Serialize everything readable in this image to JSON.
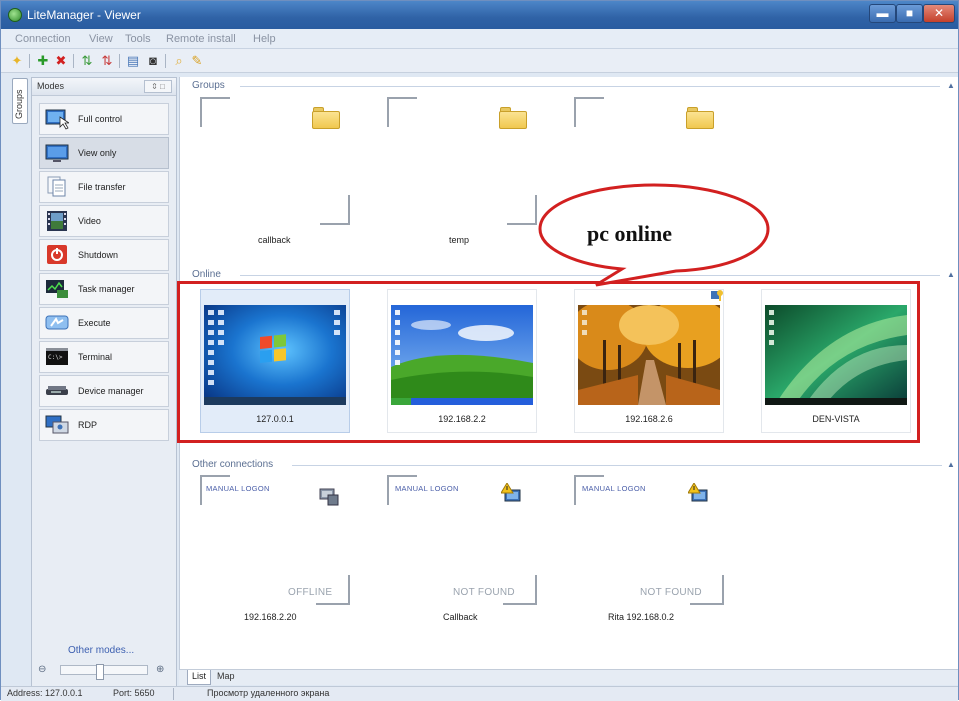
{
  "window": {
    "title": "LiteManager - Viewer",
    "controls": {
      "minimize": "▬",
      "maximize": "■",
      "close": "✕"
    }
  },
  "menu": [
    "Connection",
    "View",
    "Tools",
    "Remote install",
    "Help"
  ],
  "side_tab": "Groups",
  "modes_panel": {
    "header": "Modes",
    "header_control": "⇕ □",
    "items": [
      {
        "label": "Full control",
        "icon": "monitor-cursor-icon"
      },
      {
        "label": "View only",
        "icon": "monitor-icon",
        "selected": true
      },
      {
        "label": "File transfer",
        "icon": "files-icon"
      },
      {
        "label": "Video",
        "icon": "film-icon"
      },
      {
        "label": "Shutdown",
        "icon": "power-icon"
      },
      {
        "label": "Task manager",
        "icon": "task-manager-icon"
      },
      {
        "label": "Execute",
        "icon": "execute-icon"
      },
      {
        "label": "Terminal",
        "icon": "terminal-icon"
      },
      {
        "label": "Device manager",
        "icon": "device-manager-icon"
      },
      {
        "label": "RDP",
        "icon": "rdp-icon"
      }
    ],
    "other_modes": "Other modes...",
    "zoom_level": 0.45
  },
  "sections": {
    "groups": "Groups",
    "online": "Online",
    "other": "Other connections"
  },
  "groups": [
    {
      "label": "callback"
    },
    {
      "label": "temp"
    },
    {
      "label": ""
    }
  ],
  "online": [
    {
      "label": "127.0.0.1",
      "desktop": "windows-7",
      "selected": true
    },
    {
      "label": "192.168.2.2",
      "desktop": "windows-xp"
    },
    {
      "label": "192.168.2.6",
      "desktop": "autumn-alley"
    },
    {
      "label": "DEN-VISTA",
      "desktop": "windows-vista"
    }
  ],
  "other_connections": [
    {
      "logon": "MANUAL LOGON",
      "status": "OFFLINE",
      "label": "192.168.2.20"
    },
    {
      "logon": "MANUAL LOGON",
      "status": "NOT FOUND",
      "label": "Callback"
    },
    {
      "logon": "MANUAL LOGON",
      "status": "NOT FOUND",
      "label": "Rita 192.168.0.2"
    }
  ],
  "annotation": "pc online",
  "bottom_tabs": [
    "List",
    "Map"
  ],
  "statusbar": {
    "address": "Address: 127.0.0.1",
    "port": "Port: 5650",
    "mode": "Просмотр удаленного экрана"
  },
  "colors": {
    "highlight": "#d22020",
    "titlebar": "#2f62a6"
  }
}
